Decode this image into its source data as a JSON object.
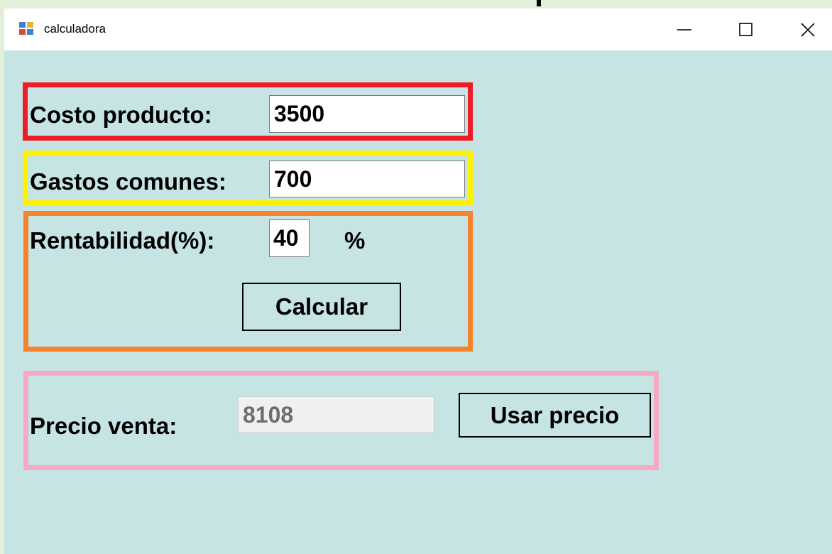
{
  "window": {
    "title": "calculadora"
  },
  "form": {
    "costo_label": "Costo producto:",
    "costo_value": "3500",
    "gastos_label": "Gastos comunes:",
    "gastos_value": "700",
    "rentabilidad_label": "Rentabilidad(%):",
    "rentabilidad_value": "40",
    "percent_symbol": "%",
    "calcular_label": "Calcular",
    "precio_label": "Precio venta:",
    "precio_value": "8108",
    "usar_precio_label": "Usar precio"
  },
  "colors": {
    "client_background": "#c6e4e4",
    "outer_background": "#e3efd9",
    "group_costo_border": "#ee1c24",
    "group_gastos_border": "#fff200",
    "group_rentabilidad_border": "#f6832b",
    "group_precio_border": "#f7a9c2"
  },
  "icons": {
    "app": "app-window-icon",
    "minimize": "minimize-icon",
    "maximize": "maximize-icon",
    "close": "close-icon"
  }
}
